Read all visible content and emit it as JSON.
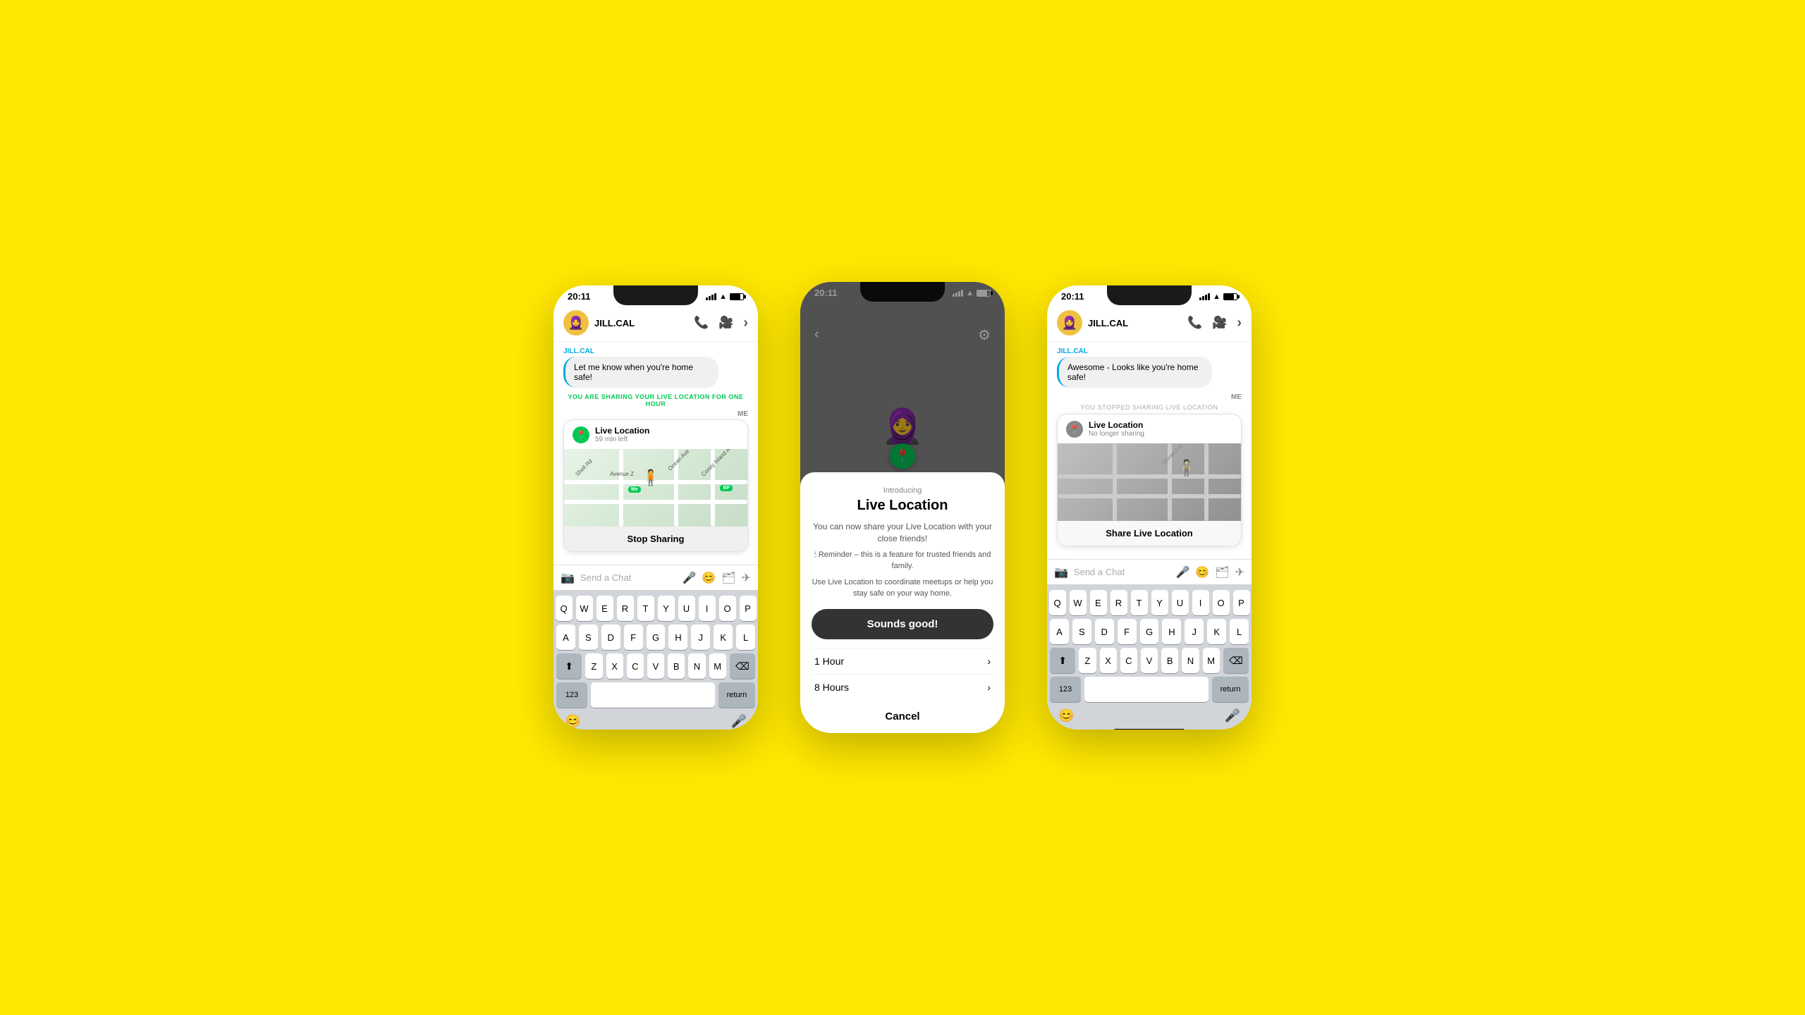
{
  "background": "#FFE800",
  "phone1": {
    "status": {
      "time": "20:11",
      "signal": "full",
      "wifi": true,
      "battery": "high"
    },
    "header": {
      "username": "JILL.CAL",
      "call_icon": "📞",
      "video_icon": "📹",
      "more_icon": "›"
    },
    "chat": {
      "username_label": "JILL.CAL",
      "message": "Let me know when you're home safe!",
      "sharing_notice": "YOU ARE SHARING YOUR",
      "sharing_highlight": "LIVE LOCATION",
      "sharing_suffix": "FOR ONE HOUR",
      "me_label": "ME",
      "location_card": {
        "title": "Live Location",
        "subtitle": "59 min left",
        "pin_icon": "📍"
      },
      "stop_sharing": "Stop Sharing"
    },
    "input": {
      "placeholder": "Send a Chat"
    },
    "keyboard": {
      "rows": [
        [
          "Q",
          "W",
          "E",
          "R",
          "T",
          "Y",
          "U",
          "I",
          "O",
          "P"
        ],
        [
          "A",
          "S",
          "D",
          "F",
          "G",
          "H",
          "J",
          "K",
          "L"
        ],
        [
          "Z",
          "X",
          "C",
          "V",
          "B",
          "N",
          "M"
        ],
        [
          "123",
          "space",
          "return"
        ]
      ]
    }
  },
  "phone2": {
    "status": {
      "time": "20:11"
    },
    "modal": {
      "intro": "Introducing",
      "title": "Live Location",
      "desc": "You can now share your Live Location with your close friends!",
      "reminder": "🕯 Reminder – this is a feature for trusted friends and family.",
      "use_desc": "Use Live Location to coordinate meetups or help you stay safe on your way home.",
      "sounds_good": "Sounds good!",
      "options": [
        {
          "label": "1 Hour",
          "arrow": "›"
        },
        {
          "label": "8 Hours",
          "arrow": "›"
        }
      ],
      "cancel": "Cancel"
    }
  },
  "phone3": {
    "status": {
      "time": "20:11",
      "signal": "full",
      "wifi": true,
      "battery": "high"
    },
    "header": {
      "username": "JILL.CAL",
      "call_icon": "📞",
      "video_icon": "📹",
      "more_icon": "›"
    },
    "chat": {
      "username_label": "JILL.CAL",
      "message": "Awesome - Looks like you're home safe!",
      "me_label": "ME",
      "stopped_notice": "YOU STOPPED SHARING LIVE LOCATION",
      "location_card": {
        "title": "Live Location",
        "subtitle": "No longer sharing",
        "pin_icon": "📍"
      },
      "share_button": "Share Live Location"
    },
    "input": {
      "placeholder": "Send a Chat"
    },
    "keyboard": {
      "rows": [
        [
          "Q",
          "W",
          "E",
          "R",
          "T",
          "Y",
          "U",
          "I",
          "O",
          "P"
        ],
        [
          "A",
          "S",
          "D",
          "F",
          "G",
          "H",
          "J",
          "K",
          "L"
        ],
        [
          "Z",
          "X",
          "C",
          "V",
          "B",
          "N",
          "M"
        ],
        [
          "123",
          "space",
          "return"
        ]
      ]
    }
  }
}
